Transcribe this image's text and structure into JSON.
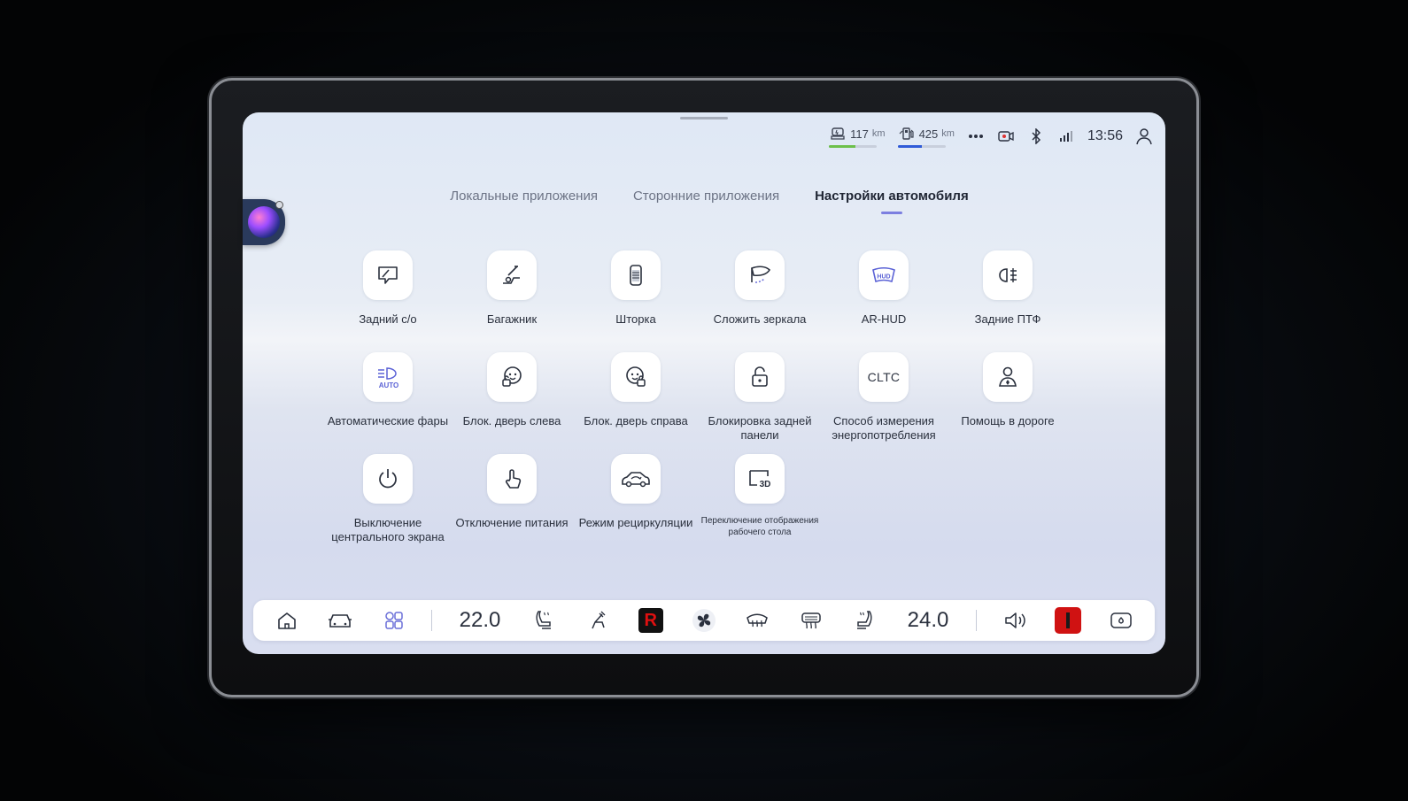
{
  "status_bar": {
    "range_electric": {
      "value": "117",
      "unit": "km",
      "level": 0.55,
      "color": "#6cc04a",
      "icon": "car-battery-icon"
    },
    "range_fuel": {
      "value": "425",
      "unit": "km",
      "level": 0.5,
      "color": "#2f5bd8",
      "icon": "fuel-pump-icon"
    },
    "icons": [
      "more-dots-icon",
      "dashcam-icon",
      "bluetooth-icon",
      "signal-icon"
    ],
    "time": "13:56",
    "profile_icon": "user-icon"
  },
  "tabs": [
    {
      "label": "Локальные приложения",
      "active": false
    },
    {
      "label": "Сторонние приложения",
      "active": false
    },
    {
      "label": "Настройки автомобиля",
      "active": true
    }
  ],
  "tiles": [
    {
      "label": "Задний с/о",
      "icon": "rear-wiper-icon"
    },
    {
      "label": "Багажник",
      "icon": "trunk-icon"
    },
    {
      "label": "Шторка",
      "icon": "sunshade-icon"
    },
    {
      "label": "Сложить зеркала",
      "icon": "fold-mirror-icon"
    },
    {
      "label": "AR-HUD",
      "icon": "hud-icon"
    },
    {
      "label": "Задние ПТФ",
      "icon": "rear-fog-light-icon"
    },
    {
      "label": "Автоматические фары",
      "icon": "auto-headlights-icon"
    },
    {
      "label": "Блок. дверь слева",
      "icon": "child-lock-left-icon"
    },
    {
      "label": "Блок. дверь справа",
      "icon": "child-lock-right-icon"
    },
    {
      "label": "Блокировка задней панели",
      "icon": "rear-panel-lock-icon"
    },
    {
      "label": "Способ измерения энергопотребления",
      "icon": "cltc-icon",
      "icon_text": "CLTC"
    },
    {
      "label": "Помощь в дороге",
      "icon": "roadside-assistance-icon"
    },
    {
      "label": "Выключение центрального экрана",
      "icon": "power-icon"
    },
    {
      "label": "Отключение питания",
      "icon": "touch-power-off-icon"
    },
    {
      "label": "Режим рециркуляции",
      "icon": "recirculation-icon"
    },
    {
      "label": "Переключение отображения рабочего стола",
      "icon": "desktop-3d-icon",
      "icon_text": "3D"
    }
  ],
  "dock": {
    "left_temp": "22.0",
    "right_temp": "24.0",
    "icons": [
      "home-icon",
      "car-icon",
      "apps-icon",
      "seat-heat-left-icon",
      "seat-adjust-icon",
      "r-app-icon",
      "fan-icon",
      "front-defrost-icon",
      "rear-defrost-icon",
      "seat-heat-right-icon",
      "volume-icon",
      "media-app-icon",
      "camera-icon"
    ],
    "r_label": "R",
    "accent_red": "#d01212"
  }
}
